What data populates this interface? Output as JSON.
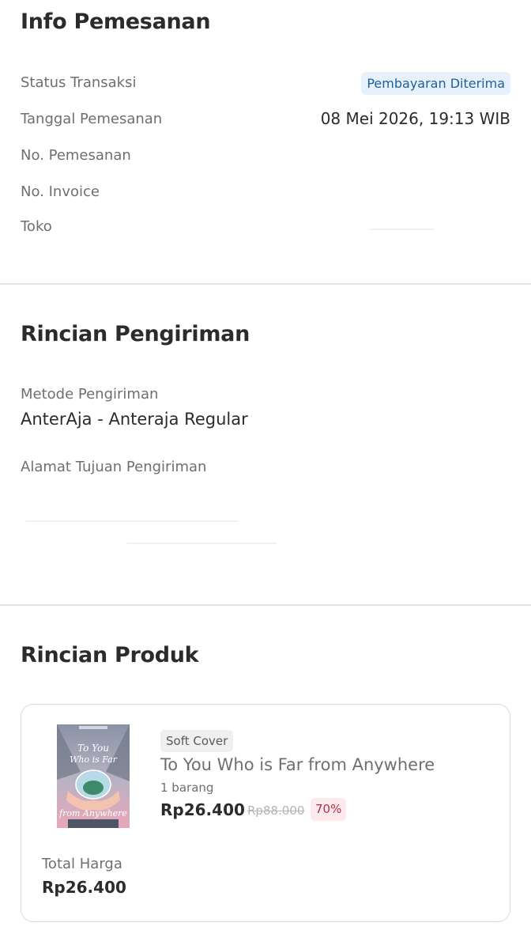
{
  "info": {
    "title": "Info Pemesanan",
    "status_label": "Status Transaksi",
    "status_value": "Pembayaran Diterima",
    "date_label": "Tanggal Pemesanan",
    "date_value": "08 Mei 2026, 19:13 WIB",
    "order_no_label": "No. Pemesanan",
    "invoice_label": "No. Invoice",
    "store_label": "Toko"
  },
  "shipping": {
    "title": "Rincian Pengiriman",
    "method_label": "Metode Pengiriman",
    "method_value": "AnterAja - Anteraja Regular",
    "address_label": "Alamat Tujuan Pengiriman"
  },
  "product": {
    "title": "Rincian Produk",
    "format": "Soft Cover",
    "name": "To You Who is Far from Anywhere",
    "quantity": "1 barang",
    "price": "Rp26.400",
    "original_price": "Rp88.000",
    "discount": "70%",
    "total_label": "Total Harga",
    "total_value": "Rp26.400",
    "cover_title": "To You Who is Far from Anywhere"
  },
  "colors": {
    "badge_bg": "#e6f1fb",
    "badge_text": "#1f5fa0",
    "discount_bg": "#fde8ec",
    "discount_text": "#b0314a"
  }
}
